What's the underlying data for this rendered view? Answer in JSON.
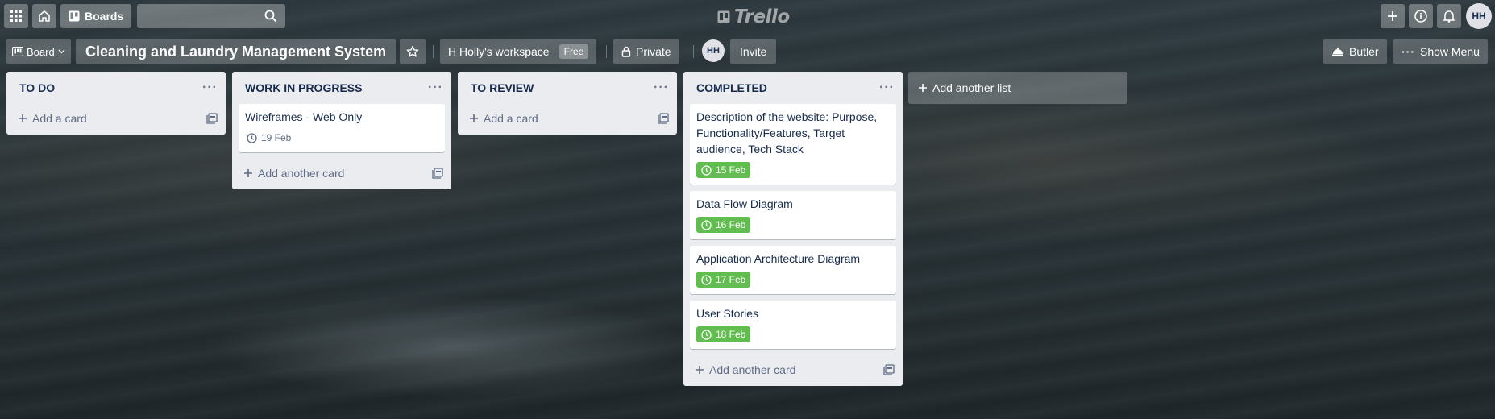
{
  "topbar": {
    "boards_label": "Boards",
    "search_placeholder": "",
    "logo_text": "Trello",
    "user_initials": "HH"
  },
  "boardbar": {
    "view_label": "Board",
    "title": "Cleaning and Laundry Management System",
    "workspace_label": "H Holly's workspace",
    "workspace_badge": "Free",
    "visibility_label": "Private",
    "member_initials": "HH",
    "invite_label": "Invite",
    "butler_label": "Butler",
    "menu_label": "Show Menu"
  },
  "lists": [
    {
      "title": "TO DO",
      "menu": "···",
      "add_label": "Add a card",
      "cards": []
    },
    {
      "title": "WORK IN PROGRESS",
      "menu": "···",
      "add_label": "Add another card",
      "cards": [
        {
          "title": "Wireframes - Web Only",
          "due": "19 Feb",
          "done": false
        }
      ]
    },
    {
      "title": "TO REVIEW",
      "menu": "···",
      "add_label": "Add a card",
      "cards": []
    },
    {
      "title": "COMPLETED",
      "menu": "···",
      "add_label": "Add another card",
      "cards": [
        {
          "title": "Description of the website: Purpose, Functionality/Features, Target audience, Tech Stack",
          "due": "15 Feb",
          "done": true
        },
        {
          "title": "Data Flow Diagram",
          "due": "16 Feb",
          "done": true
        },
        {
          "title": "Application Architecture Diagram",
          "due": "17 Feb",
          "done": true
        },
        {
          "title": "User Stories",
          "due": "18 Feb",
          "done": true
        }
      ]
    }
  ],
  "add_list_label": "Add another list",
  "colors": {
    "due_complete": "#61bd4f",
    "list_bg": "#ebecf0"
  }
}
